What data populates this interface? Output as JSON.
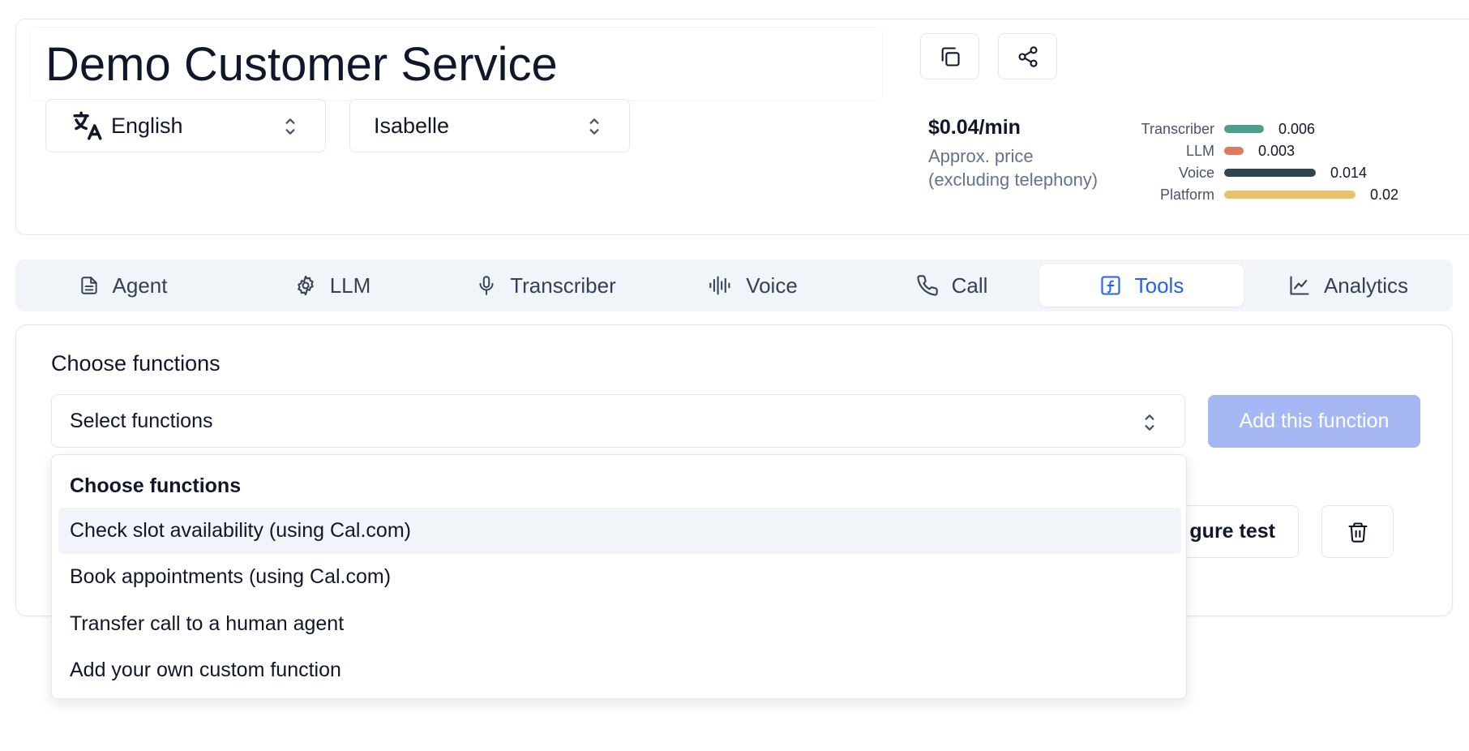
{
  "header": {
    "agent_name": "Demo Customer Service",
    "language": "English",
    "voice_name": "Isabelle",
    "copy_icon": "copy-icon",
    "share_icon": "share-icon"
  },
  "pricing": {
    "price_per_min": "$0.04/min",
    "price_note_line1": "Approx. price",
    "price_note_line2": "(excluding telephony)",
    "breakdown": [
      {
        "label": "Transcriber",
        "value": "0.006",
        "amount": 0.006,
        "color": "#4d9e8a"
      },
      {
        "label": "LLM",
        "value": "0.003",
        "amount": 0.003,
        "color": "#e07a5f"
      },
      {
        "label": "Voice",
        "value": "0.014",
        "amount": 0.014,
        "color": "#2f4550"
      },
      {
        "label": "Platform",
        "value": "0.02",
        "amount": 0.02,
        "color": "#e6c36a"
      }
    ]
  },
  "tabs": [
    {
      "label": "Agent",
      "icon": "document-icon"
    },
    {
      "label": "LLM",
      "icon": "cog-icon"
    },
    {
      "label": "Transcriber",
      "icon": "microphone-icon"
    },
    {
      "label": "Voice",
      "icon": "waveform-icon"
    },
    {
      "label": "Call",
      "icon": "phone-icon"
    },
    {
      "label": "Tools",
      "icon": "function-icon",
      "active": true
    },
    {
      "label": "Analytics",
      "icon": "chart-line-icon"
    }
  ],
  "tools": {
    "section_title": "Choose functions",
    "select_placeholder": "Select functions",
    "add_button": "Add this function",
    "config_button_partial": "gure test",
    "delete_icon": "trash-icon"
  },
  "dropdown": {
    "header": "Choose functions",
    "items": [
      "Check slot availability (using Cal.com)",
      "Book appointments (using Cal.com)",
      "Transfer call to a human agent",
      "Add your own custom function"
    ]
  },
  "colors": {
    "accent": "#2563eb",
    "add_button_disabled": "#a5b8f4",
    "tab_bar_bg": "#f1f5f9"
  }
}
